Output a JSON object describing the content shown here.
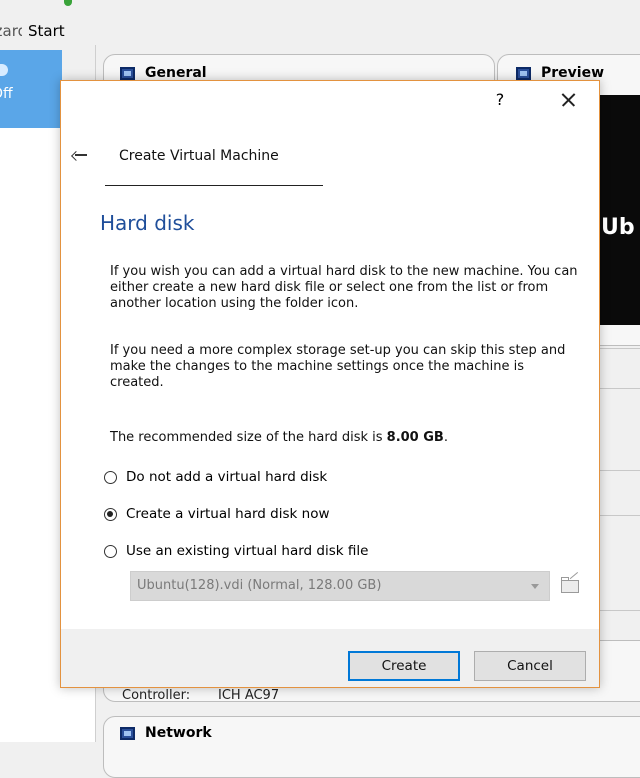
{
  "background": {
    "toolbar": {
      "wizard_partial": "Wizard",
      "start_label": "Start"
    },
    "vm_state_partial": "Off",
    "panels": {
      "general_title": "General",
      "preview_title": "Preview",
      "preview_text": "Ub",
      "audio_controller_label": "Controller:",
      "audio_controller_value": "ICH AC97",
      "network_title": "Network"
    }
  },
  "dialog": {
    "help_label": "?",
    "wizard_title": "Create Virtual Machine",
    "page_heading": "Hard disk",
    "paragraph_1": "If you wish you can add a virtual hard disk to the new machine. You can either create a new hard disk file or select one from the list or from another location using the folder icon.",
    "paragraph_2": "If you need a more complex storage set-up you can skip this step and make the changes to the machine settings once the machine is created.",
    "recommended_prefix": "The recommended size of the hard disk is ",
    "recommended_size": "8.00 GB",
    "recommended_suffix": ".",
    "options": [
      {
        "label": "Do not add a virtual hard disk",
        "checked": false
      },
      {
        "label": "Create a virtual hard disk now",
        "checked": true
      },
      {
        "label": "Use an existing virtual hard disk file",
        "checked": false
      }
    ],
    "existing_disk_combo": "Ubuntu(128).vdi (Normal, 128.00 GB)",
    "create_button": "Create",
    "cancel_button": "Cancel"
  },
  "colors": {
    "heading": "#1f4e9a",
    "dialog_border": "#e3923f",
    "default_button_border": "#0078d7",
    "selected_vm": "#5aa6e8"
  }
}
